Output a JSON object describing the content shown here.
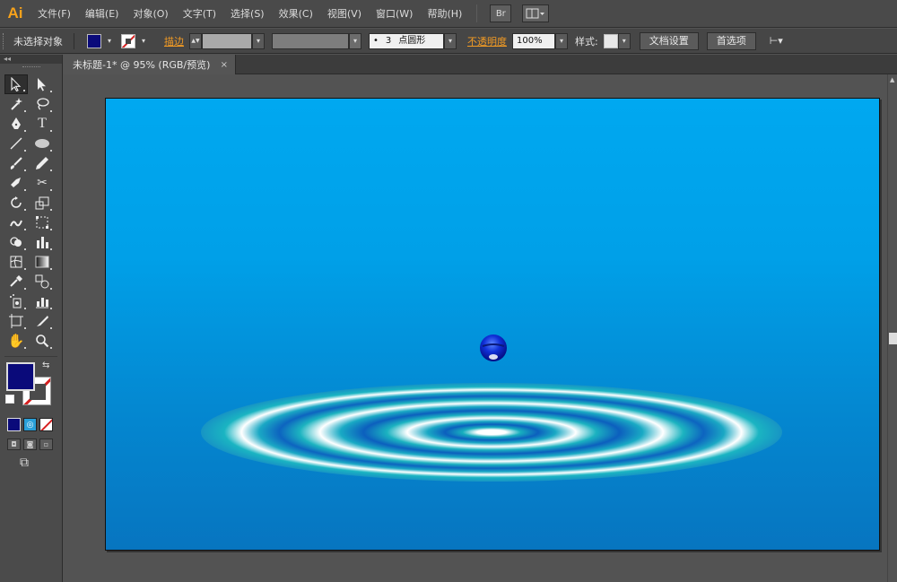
{
  "app": {
    "logo": "Ai"
  },
  "menu": {
    "items": [
      "文件(F)",
      "编辑(E)",
      "对象(O)",
      "文字(T)",
      "选择(S)",
      "效果(C)",
      "视图(V)",
      "窗口(W)",
      "帮助(H)"
    ],
    "bridge_label": "Br"
  },
  "control": {
    "selection_status": "未选择对象",
    "fill_color": "#0a0a7a",
    "stroke_label": "描边",
    "brush_size": "3",
    "brush_shape": "点圆形",
    "opacity_label": "不透明度",
    "opacity_value": "100%",
    "style_label": "样式:",
    "doc_setup_button": "文档设置",
    "prefs_button": "首选项"
  },
  "tabs": [
    {
      "title": "未标题-1* @ 95% (RGB/预览)",
      "close": "×"
    }
  ],
  "tools": {
    "collapse_arrows": "◂◂",
    "fill_color": "#0a0a7a",
    "stroke": "none"
  },
  "artwork": {
    "background_top": "#00a8f0",
    "background_bottom": "#0775c0",
    "ripple_colors": [
      "#18a4c8",
      "#ffffff",
      "#1fb5bf",
      "#0c66c0"
    ],
    "droplet_color": "#1030d8"
  }
}
